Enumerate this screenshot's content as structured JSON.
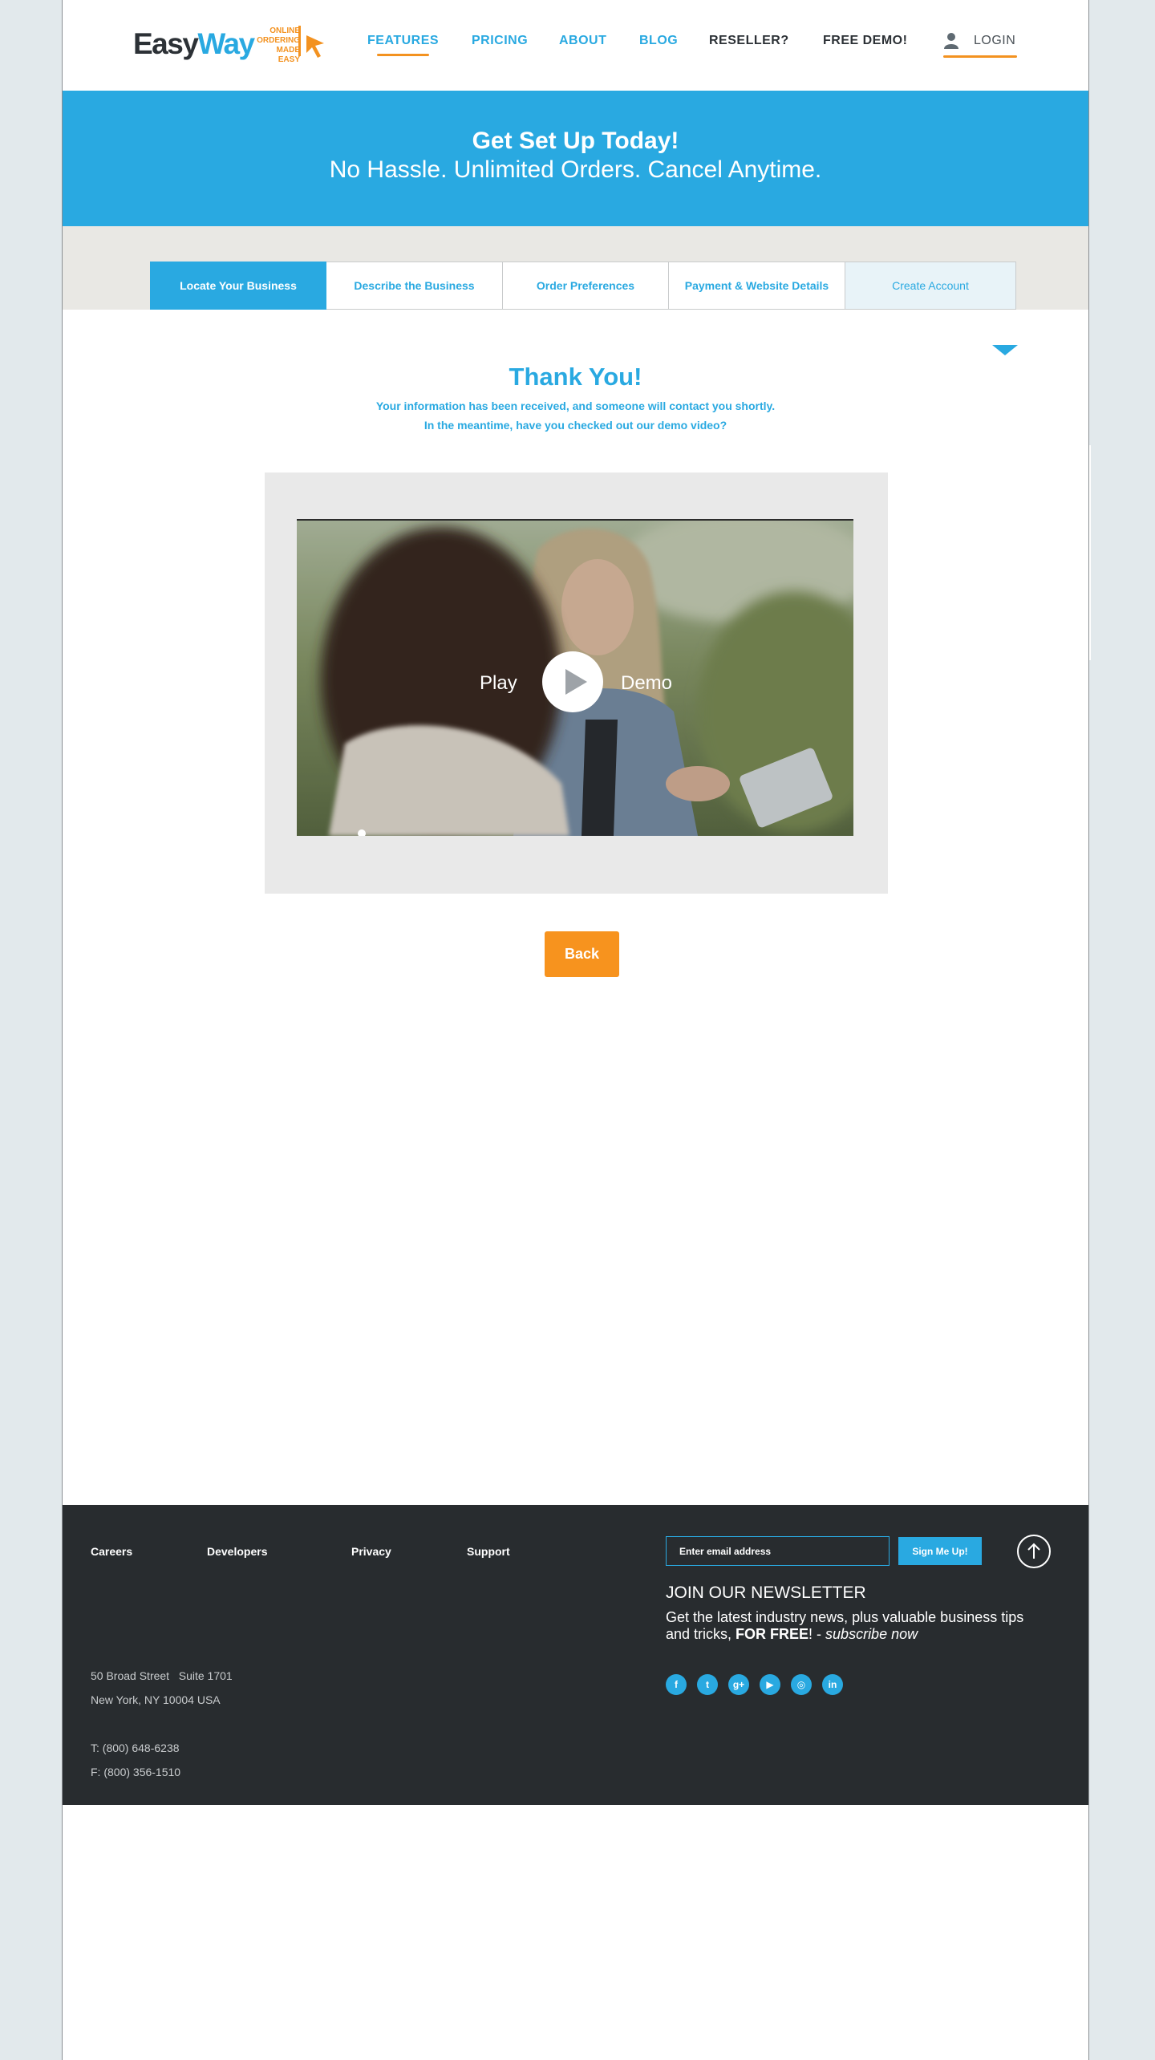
{
  "brand": {
    "name_part1": "Easy",
    "name_part2": "Way",
    "tagline": [
      "ONLINE",
      "ORDERING",
      "MADE EASY"
    ]
  },
  "nav": {
    "items": [
      {
        "label": "FEATURES",
        "active": true
      },
      {
        "label": "PRICING"
      },
      {
        "label": "ABOUT"
      },
      {
        "label": "BLOG"
      },
      {
        "label": "RESELLER?"
      },
      {
        "label": "FREE DEMO!"
      }
    ],
    "login_label": "LOGIN"
  },
  "hero": {
    "title": "Get Set Up Today!",
    "subtitle": "No Hassle. Unlimited Orders. Cancel Anytime."
  },
  "steps": [
    {
      "label": "Locate Your Business",
      "state": "completed"
    },
    {
      "label": "Describe the Business"
    },
    {
      "label": "Order Preferences"
    },
    {
      "label": "Payment & Website Details"
    },
    {
      "label": "Create Account",
      "state": "current"
    }
  ],
  "thanks": {
    "title": "Thank You!",
    "line1": "Your information has been received, and someone will contact you shortly.",
    "line2": "In the meantime, have you checked out our demo video?"
  },
  "video": {
    "left_label": "Play",
    "right_label": "Demo"
  },
  "back_label": "Back",
  "footer": {
    "links": [
      "Careers",
      "Developers",
      "Privacy",
      "Support"
    ],
    "address": {
      "street": "50 Broad Street",
      "suite": "Suite 1701",
      "city": "New York, NY 10004 USA",
      "phone": "T: (800) 648-6238",
      "fax": "F: (800) 356-1510"
    },
    "newsletter": {
      "placeholder": "Enter email address",
      "button": "Sign Me Up!",
      "title": "JOIN OUR NEWSLETTER",
      "text_part1": "Get the latest industry news, plus valuable business tips and tricks, ",
      "text_bold": "FOR FREE",
      "text_part2": "! - ",
      "text_italic": "subscribe now"
    },
    "social_icons": [
      "facebook-icon",
      "twitter-icon",
      "google-plus-icon",
      "youtube-icon",
      "instagram-icon",
      "linkedin-icon"
    ],
    "social_glyphs": [
      "f",
      "t",
      "g+",
      "▶",
      "◎",
      "in"
    ]
  },
  "colors": {
    "accent_blue": "#29a9e1",
    "accent_orange": "#f7931e",
    "footer_bg": "#282c2f",
    "band_gray": "#e9e8e4"
  }
}
